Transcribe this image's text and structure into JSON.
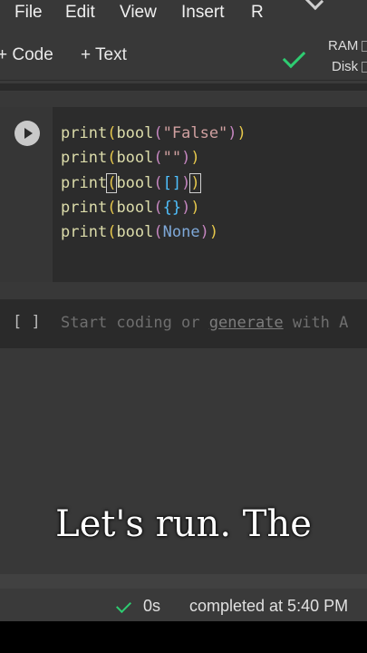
{
  "menu": {
    "items": [
      "File",
      "Edit",
      "View",
      "Insert",
      "R"
    ]
  },
  "toolbar": {
    "add_code_label": "+ Code",
    "add_text_label": "+ Text",
    "ram_label": "RAM",
    "disk_label": "Disk"
  },
  "cell": {
    "lines": [
      "print(bool(\"False\"))",
      "print(bool(\"\"))",
      "print(bool([]))",
      "print(bool({}))",
      "print(bool(None))"
    ]
  },
  "empty_cell": {
    "brackets": "[ ]",
    "placeholder_prefix": "Start coding or ",
    "placeholder_link": "generate",
    "placeholder_suffix": " with A"
  },
  "caption": "Let's run. The",
  "status": {
    "duration": "0s",
    "completed": "completed at 5:40 PM"
  },
  "colors": {
    "accent_green": "#2ecc71"
  }
}
